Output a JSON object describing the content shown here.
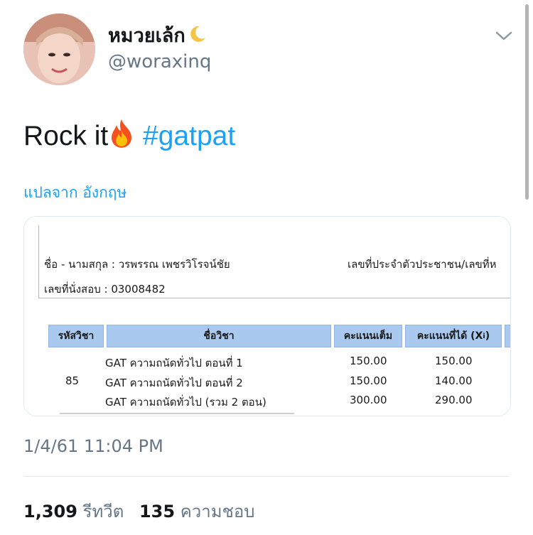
{
  "tweet": {
    "display_name": "หมวยเล้ก",
    "handle": "@woraxinq",
    "text_plain": "Rock it",
    "hashtag": "#gatpat",
    "translate_label": "แปลจาก อังกฤษ",
    "timestamp": "1/4/61 11:04 PM",
    "retweet_count": "1,309",
    "retweet_label": "รีทวีต",
    "like_count": "135",
    "like_label": "ความชอบ"
  },
  "attachment": {
    "name_line": "ชื่อ - นามสกุล : วรพรรณ เพชรวิโรจน์ชัย",
    "id_line": "เลขที่ประจำตัวประชาชน/เลขที่ห",
    "seat_line": "เลขที่นั่งสอบ : 03008482",
    "headers": [
      "รหัสวิชา",
      "ชื่อวิชา",
      "คะแนนเต็ม",
      "คะแนนที่ได้ (X",
      "i",
      ")"
    ],
    "rows": [
      {
        "code": "",
        "subject": "GAT ความถนัดทั่วไป ตอนที่ 1",
        "full": "150.00",
        "got": "150.00"
      },
      {
        "code": "85",
        "subject": "GAT ความถนัดทั่วไป ตอนที่ 2",
        "full": "150.00",
        "got": "140.00"
      },
      {
        "code": "",
        "subject": "GAT ความถนัดทั่วไป (รวม 2 ตอน)",
        "full": "300.00",
        "got": "290.00"
      }
    ]
  },
  "icons": [
    "moon-icon",
    "fire-icon",
    "chevron-down-icon"
  ],
  "colors": {
    "link": "#1da1f2",
    "muted": "#657786",
    "table_header": "#a9c9ee"
  }
}
